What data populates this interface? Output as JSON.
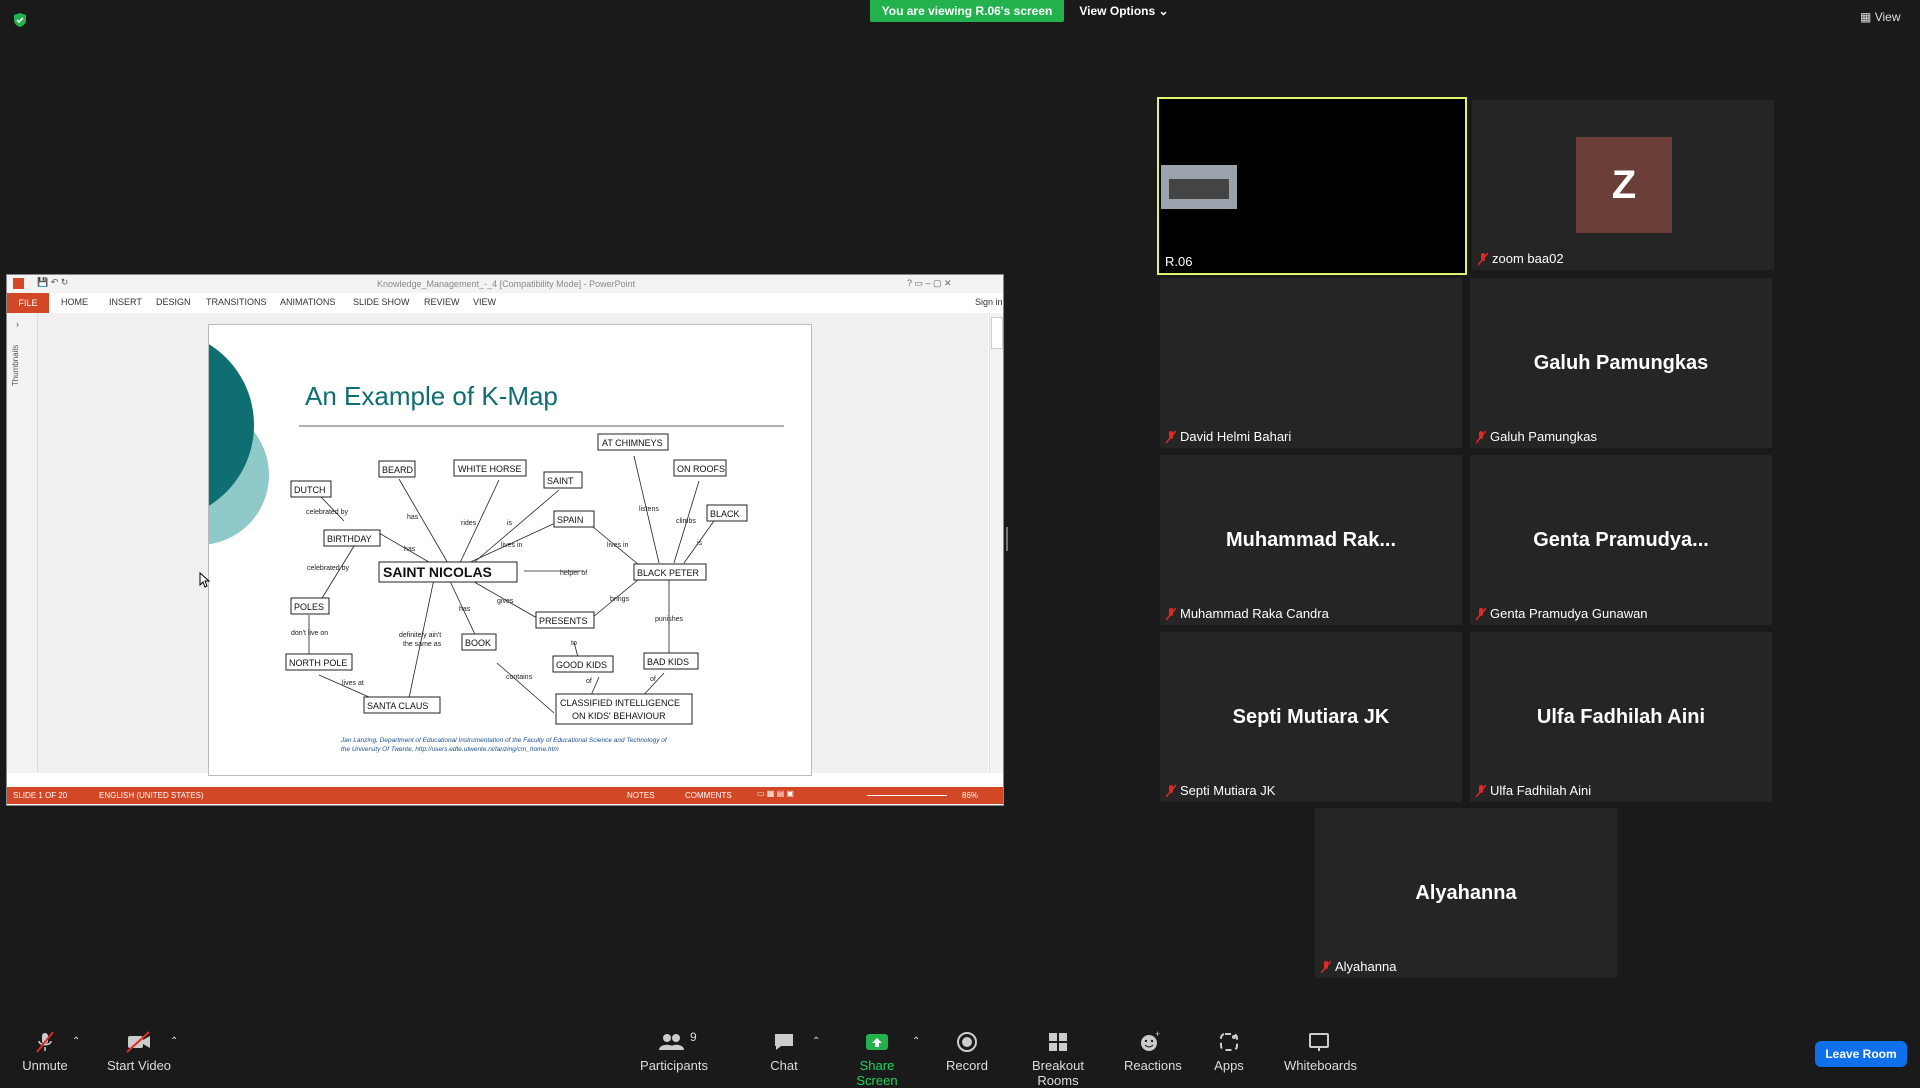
{
  "top": {
    "banner": "You are viewing R.06's screen",
    "view_options": "View Options",
    "view": "View"
  },
  "ppt": {
    "title": "Knowledge_Management_-_4 [Compatibility Mode] - PowerPoint",
    "tabs": [
      "FILE",
      "HOME",
      "INSERT",
      "DESIGN",
      "TRANSITIONS",
      "ANIMATIONS",
      "SLIDE SHOW",
      "REVIEW",
      "VIEW"
    ],
    "sign_in": "Sign in",
    "thumbnails": "Thumbnails",
    "status": {
      "slide": "SLIDE 1 OF 20",
      "language": "ENGLISH (UNITED STATES)",
      "notes": "NOTES",
      "comments": "COMMENTS",
      "zoom": "86%"
    },
    "slide": {
      "title": "An Example of K-Map",
      "nodes": [
        "AT CHIMNEYS",
        "BEARD",
        "WHITE HORSE",
        "ON ROOFS",
        "SAINT",
        "DUTCH",
        "SPAIN",
        "BLACK",
        "BIRTHDAY",
        "SAINT NICOLAS",
        "BLACK PETER",
        "POLES",
        "PRESENTS",
        "BOOK",
        "NORTH POLE",
        "GOOD KIDS",
        "BAD KIDS",
        "SANTA CLAUS",
        "CLASSIFIED INTELLIGENCE",
        "ON KIDS' BEHAVIOUR"
      ],
      "links": [
        "has",
        "rides",
        "is",
        "celebrated by",
        "has",
        "lives in",
        "listens",
        "climbs",
        "is",
        "lives in",
        "celebrated by",
        "helper of",
        "gives",
        "brings",
        "has",
        "punishes",
        "don't live on",
        "definitely ain't",
        "the same as",
        "to",
        "of",
        "of",
        "contains",
        "lives at"
      ],
      "credit1": "Jan Lanzing, Department of Educational Instrumentation of the Faculty of Educational Science and Technology of",
      "credit2": "the University Of Twente, http://users.edte.utwente.nl/lanzing/cm_home.htm"
    }
  },
  "participants": [
    {
      "name": "R.06",
      "center": "",
      "muted": false
    },
    {
      "name": "zoom baa02",
      "center": "Z",
      "muted": true
    },
    {
      "name": "David Helmi Bahari",
      "center": "",
      "muted": true
    },
    {
      "name": "Galuh Pamungkas",
      "center": "Galuh Pamungkas",
      "muted": true
    },
    {
      "name": "Muhammad Raka Candra",
      "center": "Muhammad  Rak...",
      "muted": true
    },
    {
      "name": "Genta Pramudya Gunawan",
      "center": "Genta  Pramudya...",
      "muted": true
    },
    {
      "name": "Septi Mutiara JK",
      "center": "Septi Mutiara JK",
      "muted": true
    },
    {
      "name": "Ulfa Fadhilah Aini",
      "center": "Ulfa Fadhilah Aini",
      "muted": true
    },
    {
      "name": "Alyahanna",
      "center": "Alyahanna",
      "muted": true
    }
  ],
  "toolbar": {
    "unmute": "Unmute",
    "start_video": "Start Video",
    "participants": "Participants",
    "participants_count": "9",
    "chat": "Chat",
    "share_screen": "Share Screen",
    "record": "Record",
    "breakout_rooms": "Breakout Rooms",
    "reactions": "Reactions",
    "apps": "Apps",
    "whiteboards": "Whiteboards",
    "leave_room": "Leave Room"
  },
  "colors": {
    "share_green": "#23b14d",
    "active_border": "#e4f26c",
    "leave_blue": "#0e71eb",
    "ppt_red": "#d24726",
    "slide_teal": "#0f6e72"
  }
}
